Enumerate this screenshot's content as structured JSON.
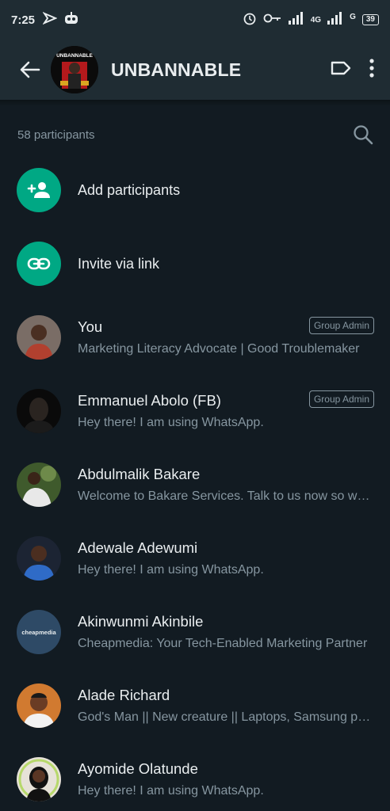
{
  "status_bar": {
    "time": "7:25",
    "network_label": "4G",
    "signal_label": "G",
    "battery": "39"
  },
  "header": {
    "title": "UNBANNABLE",
    "group_image_text": "UNBANNABLE"
  },
  "participants_header": {
    "count_label": "58 participants"
  },
  "actions": [
    {
      "label": "Add participants",
      "icon": "add-person-icon"
    },
    {
      "label": "Invite via link",
      "icon": "link-icon"
    }
  ],
  "participants": [
    {
      "name": "You",
      "about": "Marketing Literacy Advocate | Good Troublemaker",
      "badge": "Group Admin",
      "avatar_color": "#5a4a42"
    },
    {
      "name": "Emmanuel Abolo (FB)",
      "about": "Hey there! I am using WhatsApp.",
      "badge": "Group Admin",
      "avatar_color": "#111111"
    },
    {
      "name": "Abdulmalik Bakare",
      "about": "Welcome to Bakare Services. Talk to us now so we can help",
      "badge": "",
      "avatar_color": "#4f6b3a"
    },
    {
      "name": "Adewale Adewumi",
      "about": "Hey there! I am using WhatsApp.",
      "badge": "",
      "avatar_color": "#2b3a55"
    },
    {
      "name": "Akinwunmi Akinbile",
      "about": "Cheapmedia: Your Tech-Enabled Marketing Partner",
      "badge": "",
      "avatar_color": "#2e4a66",
      "avatar_text": "cheapmedia"
    },
    {
      "name": "Alade Richard",
      "about": "God's Man || New creature || Laptops, Samsung phones",
      "badge": "",
      "avatar_color": "#c46a2a"
    },
    {
      "name": "Ayomide Olatunde",
      "about": "Hey there! I am using WhatsApp.",
      "badge": "",
      "avatar_color": "#e7e2d8"
    }
  ],
  "colors": {
    "accent": "#00a884",
    "background": "#121b22",
    "header": "#1f2c33",
    "secondary_text": "#8696a0"
  }
}
